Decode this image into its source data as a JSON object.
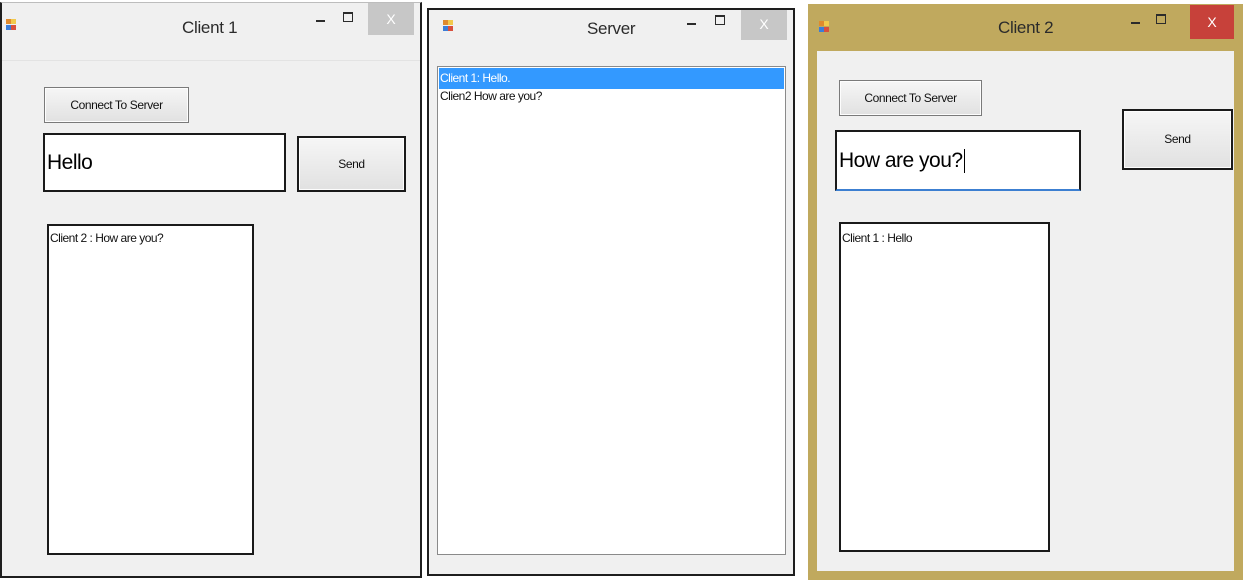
{
  "colors": {
    "window_bg": "#f0f0f0",
    "inactive_frame": "#1e1e1e",
    "active_frame": "#c0a95e",
    "close_inactive": "#c7c7c7",
    "close_active": "#c7413a",
    "selection": "#3399ff"
  },
  "client1": {
    "title": "Client 1",
    "connect_label": "Connect To Server",
    "message_value": "Hello",
    "send_label": "Send",
    "messages": [
      "Client 2 : How are you?"
    ],
    "controls": {
      "minimize": "minimize-icon",
      "maximize": "maximize-icon",
      "close": "X"
    }
  },
  "server": {
    "title": "Server",
    "log": [
      "Client 1: Hello.",
      "Clien2 How are you?"
    ],
    "selected_index": 0,
    "controls": {
      "minimize": "minimize-icon",
      "maximize": "maximize-icon",
      "close": "X"
    }
  },
  "client2": {
    "title": "Client 2",
    "connect_label": "Connect To Server",
    "message_value": "How are you?",
    "send_label": "Send",
    "messages": [
      "Client 1 : Hello"
    ],
    "controls": {
      "minimize": "minimize-icon",
      "maximize": "maximize-icon",
      "close": "X"
    }
  }
}
